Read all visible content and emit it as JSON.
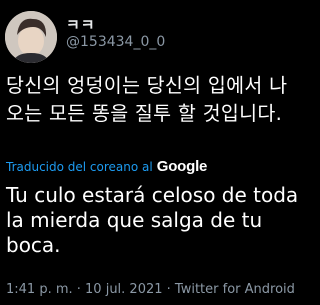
{
  "tweet": {
    "display_name": "ㅋㅋ",
    "handle": "@153434_0_0",
    "korean_text": "당신의 엉덩이는 당신의 입에서 나오는 모든 똥을 질투 할 것입니다.",
    "translate_label": "Traducido del coreano al",
    "translate_provider": "Google",
    "translation_text": "Tu culo estará celoso de toda la mierda que salga de tu boca.",
    "timestamp": "1:41 p. m. · 10 jul. 2021 · Twitter for Android"
  },
  "colors": {
    "background": "#000000",
    "link": "#1d9bf0",
    "secondary_text": "#8b98a5"
  }
}
